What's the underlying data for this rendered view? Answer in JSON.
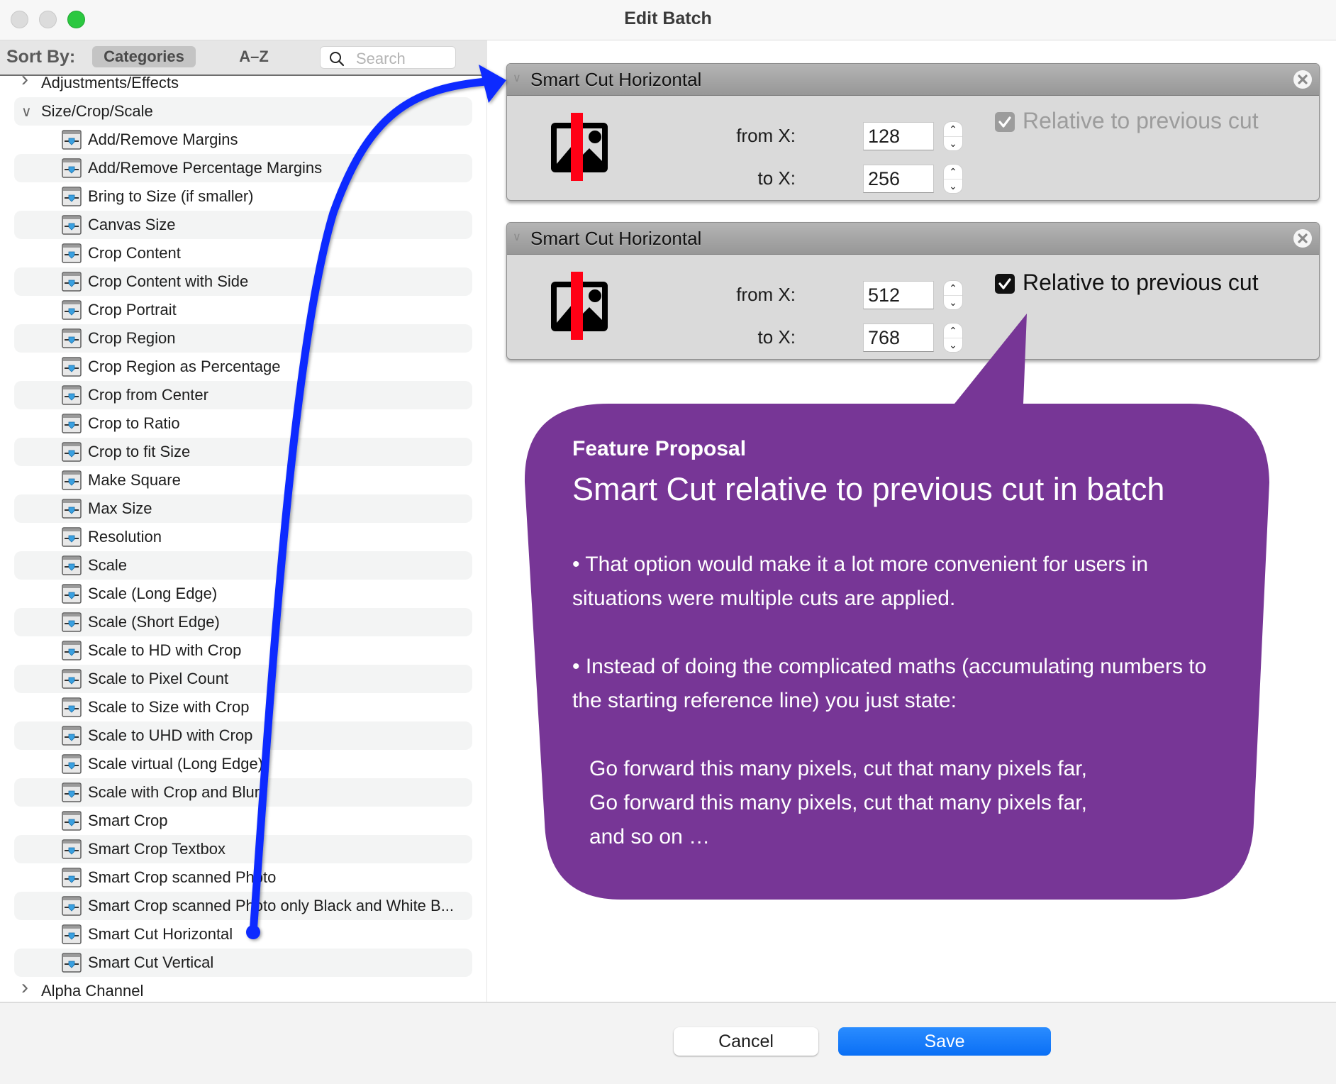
{
  "window": {
    "title": "Edit Batch",
    "controls": [
      "close",
      "minimize",
      "zoom"
    ]
  },
  "sidebar": {
    "sort_label": "Sort By:",
    "sort_options": [
      {
        "label": "Categories",
        "selected": true
      },
      {
        "label": "A–Z",
        "selected": false
      }
    ],
    "search": {
      "placeholder": "Search",
      "value": ""
    },
    "tree": [
      {
        "type": "category",
        "label": "Adjustments/Effects",
        "expanded": false
      },
      {
        "type": "category",
        "label": "Size/Crop/Scale",
        "expanded": true
      },
      {
        "type": "item",
        "label": "Add/Remove Margins"
      },
      {
        "type": "item",
        "label": "Add/Remove Percentage Margins"
      },
      {
        "type": "item",
        "label": "Bring to Size (if smaller)"
      },
      {
        "type": "item",
        "label": "Canvas Size"
      },
      {
        "type": "item",
        "label": "Crop Content"
      },
      {
        "type": "item",
        "label": "Crop Content with Side"
      },
      {
        "type": "item",
        "label": "Crop Portrait"
      },
      {
        "type": "item",
        "label": "Crop Region"
      },
      {
        "type": "item",
        "label": "Crop Region as Percentage"
      },
      {
        "type": "item",
        "label": "Crop from Center"
      },
      {
        "type": "item",
        "label": "Crop to Ratio"
      },
      {
        "type": "item",
        "label": "Crop to fit Size"
      },
      {
        "type": "item",
        "label": "Make Square"
      },
      {
        "type": "item",
        "label": "Max Size"
      },
      {
        "type": "item",
        "label": "Resolution"
      },
      {
        "type": "item",
        "label": "Scale"
      },
      {
        "type": "item",
        "label": "Scale (Long Edge)"
      },
      {
        "type": "item",
        "label": "Scale (Short Edge)"
      },
      {
        "type": "item",
        "label": "Scale to HD with Crop"
      },
      {
        "type": "item",
        "label": "Scale to Pixel Count"
      },
      {
        "type": "item",
        "label": "Scale to Size with Crop"
      },
      {
        "type": "item",
        "label": "Scale to UHD with Crop"
      },
      {
        "type": "item",
        "label": "Scale virtual (Long Edge)"
      },
      {
        "type": "item",
        "label": "Scale with Crop and Blur"
      },
      {
        "type": "item",
        "label": "Smart Crop"
      },
      {
        "type": "item",
        "label": "Smart Crop Textbox"
      },
      {
        "type": "item",
        "label": "Smart Crop scanned Photo"
      },
      {
        "type": "item",
        "label": "Smart Crop scanned Photo only Black and White B..."
      },
      {
        "type": "item",
        "label": "Smart Cut Horizontal"
      },
      {
        "type": "item",
        "label": "Smart Cut Vertical"
      },
      {
        "type": "category",
        "label": "Alpha Channel",
        "expanded": false
      }
    ]
  },
  "batch_steps": [
    {
      "title": "Smart Cut Horizontal",
      "icon": "smart-cut-horizontal-icon",
      "from_label": "from X:",
      "from_value": "128",
      "to_label": "to X:",
      "to_value": "256",
      "relative_label": "Relative to previous cut",
      "relative_checked": true,
      "relative_enabled": false
    },
    {
      "title": "Smart Cut Horizontal",
      "icon": "smart-cut-horizontal-icon",
      "from_label": "from X:",
      "from_value": "512",
      "to_label": "to X:",
      "to_value": "768",
      "relative_label": "Relative to previous cut",
      "relative_checked": true,
      "relative_enabled": true
    }
  ],
  "callout": {
    "kicker": "Feature Proposal",
    "title": "Smart Cut relative to previous cut in batch",
    "paragraphs": [
      "• That option would make it a lot more convenient for users in situations were multiple cuts are applied.",
      "• Instead of doing the complicated maths (accumulating numbers to the starting reference line) you just state:"
    ],
    "quote_lines": [
      "Go forward this many pixels, cut that many pixels far,",
      "Go forward this many pixels, cut that many pixels far,",
      "and so on …"
    ],
    "color": "#773696"
  },
  "annotation_arrow": {
    "color": "#0a2cff",
    "from": "sidebar item Smart Cut Horizontal",
    "to": "first batch step panel"
  },
  "footer": {
    "cancel_label": "Cancel",
    "save_label": "Save"
  },
  "colors": {
    "accent": "#0a6ff5",
    "window_zoom": "#2bc840",
    "cut_line": "#ff0015"
  }
}
